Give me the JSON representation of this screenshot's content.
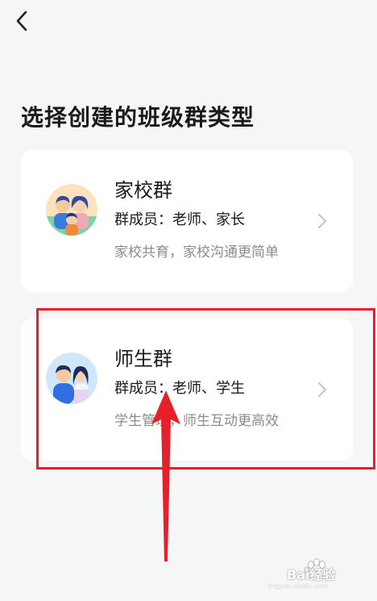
{
  "header": {
    "back_icon": "chevron-left-icon",
    "title": "选择创建的班级群类型"
  },
  "group_types": [
    {
      "title": "家校群",
      "members": "群成员：老师、家长",
      "description": "家校共育，家校沟通更简单",
      "icon": "family-avatar-icon"
    },
    {
      "title": "师生群",
      "members": "群成员：老师、学生",
      "description": "学生管理，师生互动更高效",
      "icon": "teacher-student-avatar-icon"
    }
  ],
  "annotation": {
    "highlight_color": "#e5202a",
    "arrow_color": "#e5202a"
  },
  "watermark": {
    "text": "Bai经验",
    "subtext": "jingyan.baidu.com"
  }
}
